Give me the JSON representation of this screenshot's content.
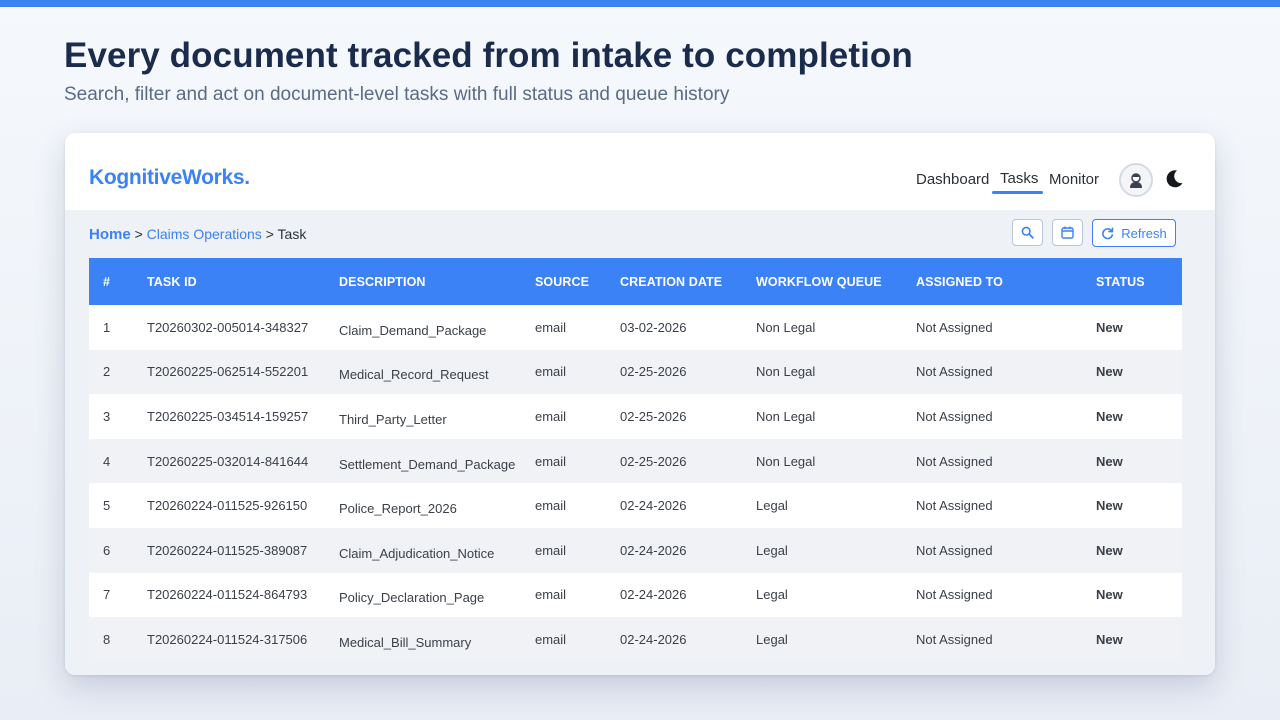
{
  "hero": {
    "title": "Every document tracked from intake to completion",
    "subtitle": "Search, filter and act on document-level tasks with full status and queue history"
  },
  "app": {
    "logo": "KognitiveWorks.",
    "nav": {
      "dashboard": "Dashboard",
      "tasks": "Tasks",
      "monitor": "Monitor",
      "active": "Tasks"
    },
    "breadcrumb": {
      "home": "Home",
      "sep": ">",
      "section": "Claims Operations",
      "current": "Task"
    },
    "toolbar": {
      "refresh_label": "Refresh"
    },
    "icons": {
      "search": "search-icon",
      "calendar": "calendar-icon",
      "refresh": "refresh-icon",
      "avatar": "user-avatar-icon",
      "theme": "moon-icon"
    },
    "colors": {
      "accent": "#3b82f6",
      "title": "#1a2b4c",
      "status_new": "#3b82f6"
    }
  },
  "table": {
    "headers": [
      "#",
      "TASK ID",
      "DESCRIPTION",
      "SOURCE",
      "CREATION DATE",
      "WORKFLOW QUEUE",
      "ASSIGNED TO",
      "STATUS"
    ],
    "rows": [
      {
        "num": "1",
        "task_id": "T20260302-005014-348327",
        "description": "Claim_Demand_Package",
        "source": "email",
        "date": "03-02-2026",
        "queue": "Non Legal",
        "assigned": "Not Assigned",
        "status": "New"
      },
      {
        "num": "2",
        "task_id": "T20260225-062514-552201",
        "description": "Medical_Record_Request",
        "source": "email",
        "date": "02-25-2026",
        "queue": "Non Legal",
        "assigned": "Not Assigned",
        "status": "New"
      },
      {
        "num": "3",
        "task_id": "T20260225-034514-159257",
        "description": "Third_Party_Letter",
        "source": "email",
        "date": "02-25-2026",
        "queue": "Non Legal",
        "assigned": "Not Assigned",
        "status": "New"
      },
      {
        "num": "4",
        "task_id": "T20260225-032014-841644",
        "description": "Settlement_Demand_Package",
        "source": "email",
        "date": "02-25-2026",
        "queue": "Non Legal",
        "assigned": "Not Assigned",
        "status": "New"
      },
      {
        "num": "5",
        "task_id": "T20260224-011525-926150",
        "description": "Police_Report_2026",
        "source": "email",
        "date": "02-24-2026",
        "queue": "Legal",
        "assigned": "Not Assigned",
        "status": "New"
      },
      {
        "num": "6",
        "task_id": "T20260224-011525-389087",
        "description": "Claim_Adjudication_Notice",
        "source": "email",
        "date": "02-24-2026",
        "queue": "Legal",
        "assigned": "Not Assigned",
        "status": "New"
      },
      {
        "num": "7",
        "task_id": "T20260224-011524-864793",
        "description": "Policy_Declaration_Page",
        "source": "email",
        "date": "02-24-2026",
        "queue": "Legal",
        "assigned": "Not Assigned",
        "status": "New"
      },
      {
        "num": "8",
        "task_id": "T20260224-011524-317506",
        "description": "Medical_Bill_Summary",
        "source": "email",
        "date": "02-24-2026",
        "queue": "Legal",
        "assigned": "Not Assigned",
        "status": "New"
      }
    ]
  }
}
